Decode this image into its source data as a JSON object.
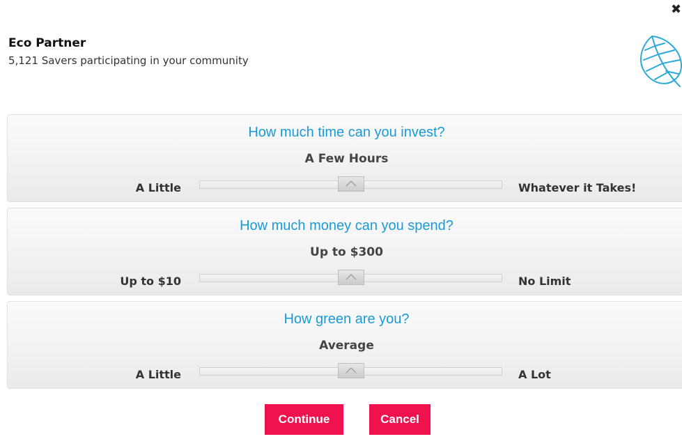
{
  "header": {
    "title": "Eco Partner",
    "subtitle": "5,121 Savers participating in your community",
    "leaf_icon": "leaf-icon"
  },
  "close_icon": "close-icon",
  "sliders": [
    {
      "question": "How much time can you invest?",
      "answer": "A Few Hours",
      "min_label": "A Little",
      "max_label": "Whatever it Takes!",
      "value": 0.5
    },
    {
      "question": "How much money can you spend?",
      "answer": "Up to $300",
      "min_label": "Up to $10",
      "max_label": "No Limit",
      "value": 0.5
    },
    {
      "question": "How green are you?",
      "answer": "Average",
      "min_label": "A Little",
      "max_label": "A Lot",
      "value": 0.5
    }
  ],
  "buttons": {
    "continue": "Continue",
    "cancel": "Cancel"
  },
  "colors": {
    "accent_blue": "#1a9ad6",
    "button_red": "#f0124e"
  }
}
